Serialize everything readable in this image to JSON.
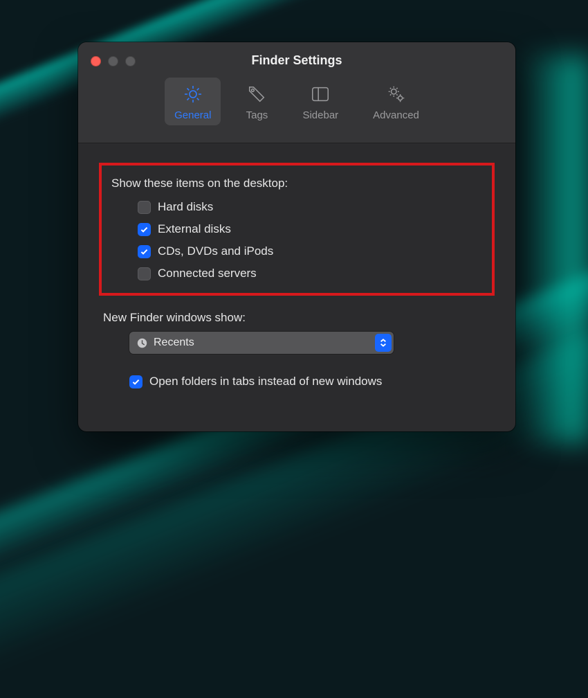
{
  "window": {
    "title": "Finder Settings"
  },
  "toolbar": {
    "general": "General",
    "tags": "Tags",
    "sidebar": "Sidebar",
    "advanced": "Advanced"
  },
  "desktop_section": {
    "label": "Show these items on the desktop:",
    "items": {
      "hard_disks": {
        "label": "Hard disks",
        "checked": false
      },
      "external_disks": {
        "label": "External disks",
        "checked": true
      },
      "cds": {
        "label": "CDs, DVDs and iPods",
        "checked": true
      },
      "servers": {
        "label": "Connected servers",
        "checked": false
      }
    }
  },
  "new_finder": {
    "label": "New Finder windows show:",
    "selected": "Recents"
  },
  "tabs_option": {
    "label": "Open folders in tabs instead of new windows",
    "checked": true
  }
}
